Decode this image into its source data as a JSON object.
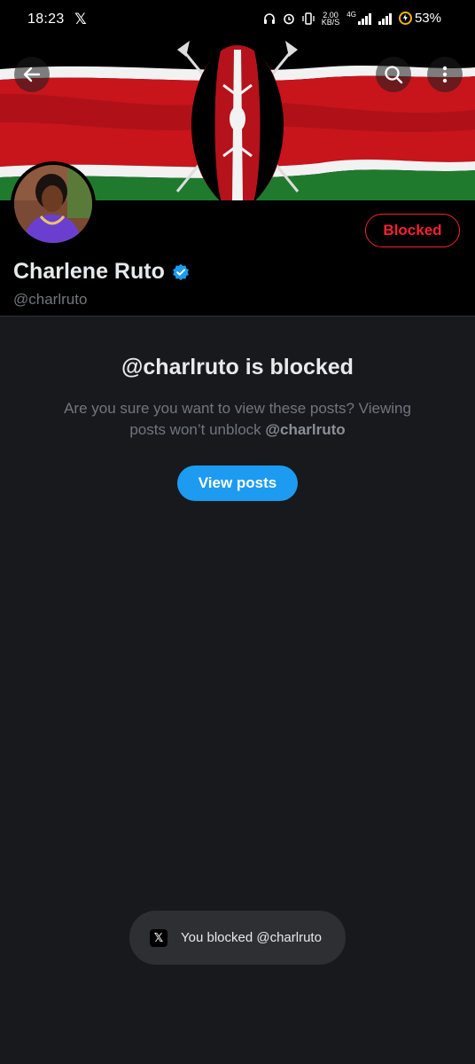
{
  "status_bar": {
    "time": "18:23",
    "app_icon": "x-logo-icon",
    "speed_value": "2.00",
    "speed_unit": "KB/S",
    "network": "4G",
    "battery": "53%"
  },
  "header": {
    "back_icon": "back-arrow-icon",
    "search_icon": "search-icon",
    "more_icon": "more-vertical-icon",
    "banner": "kenya-flag-banner"
  },
  "profile": {
    "name": "Charlene Ruto",
    "handle": "@charlruto",
    "verified_icon": "verified-badge-icon",
    "blocked_button": "Blocked"
  },
  "notice": {
    "title": "@charlruto is blocked",
    "message": "Are you sure you want to view these posts? Viewing posts won’t unblock ",
    "message_handle": "@charlruto",
    "view_button": "View posts"
  },
  "toast": {
    "icon": "x-logo-icon",
    "text": "You blocked @charlruto"
  },
  "colors": {
    "background": "#17191d",
    "accent": "#1d9bf0",
    "blocked_red": "#f4212e",
    "muted": "#71767b"
  }
}
